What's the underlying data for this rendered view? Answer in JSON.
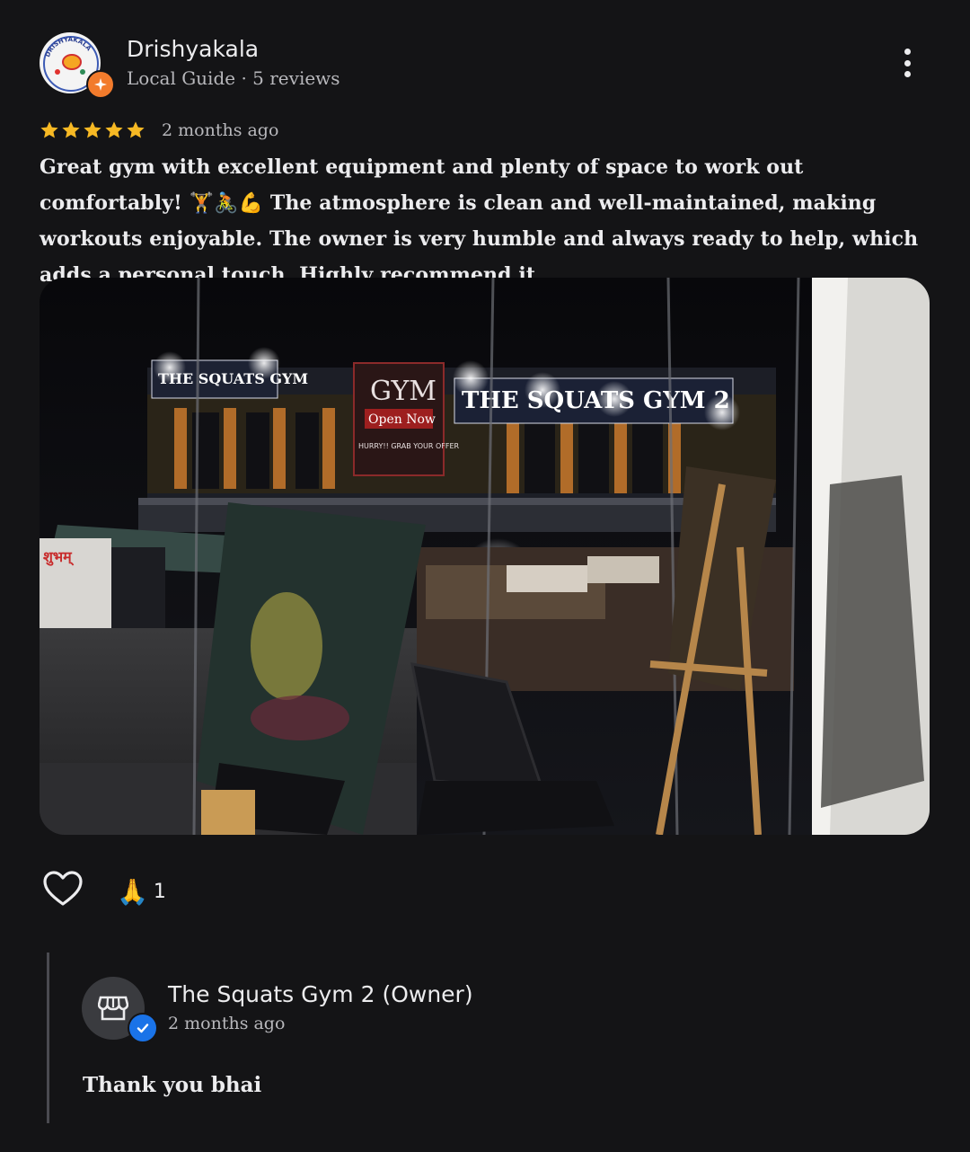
{
  "reviewer": {
    "name": "Drishyakala",
    "meta": "Local Guide · 5 reviews",
    "avatar_text": "DRISHYAKALA"
  },
  "review": {
    "rating": 5,
    "time": "2 months ago",
    "text": "Great gym with excellent equipment and plenty of space to work out comfortably! 🏋🚴💪 The atmosphere is clean and well-maintained, making workouts enjoyable. The owner is very humble and always ready to help, which adds a personal touch. Highly recommend it.",
    "photo": {
      "sign_gym": "GYM",
      "sign_open": "Open Now",
      "sign_offer": "HURRY!! GRAB YOUR OFFER",
      "sign_left": "THE SQUATS GYM",
      "sign_main": "THE SQUATS GYM 2",
      "sign_shop": "शुभम्"
    }
  },
  "reactions": {
    "emoji": "🙏",
    "count": "1"
  },
  "reply": {
    "owner_name": "The Squats Gym 2 (Owner)",
    "time": "2 months ago",
    "text": "Thank you bhai"
  },
  "colors": {
    "star": "#f7b924",
    "guide_badge": "#f27b2c",
    "verified": "#1a73e8",
    "background": "#141416"
  }
}
